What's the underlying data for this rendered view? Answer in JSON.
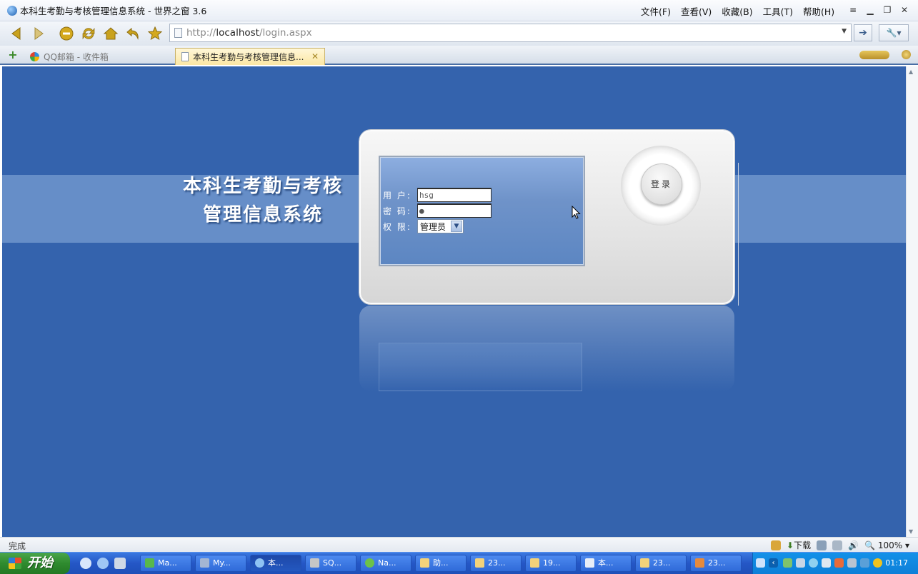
{
  "window": {
    "title": "本科生考勤与考核管理信息系统 - 世界之窗 3.6",
    "menus": [
      "文件(F)",
      "查看(V)",
      "收藏(B)",
      "工具(T)",
      "帮助(H)"
    ]
  },
  "address_bar": {
    "url_prefix": "http://",
    "url_host": "localhost",
    "url_path": "/login.aspx"
  },
  "tabs": [
    {
      "label": "QQ邮箱 - 收件箱",
      "active": false
    },
    {
      "label": "本科生考勤与考核管理信息...",
      "active": true
    }
  ],
  "page": {
    "system_title_line1": "本科生考勤与考核",
    "system_title_line2": "管理信息系统",
    "form": {
      "user_label": "用  户:",
      "user_value": "hsg",
      "password_label": "密  码:",
      "password_value": "●",
      "role_label": "权  限:",
      "role_value": "管理员"
    },
    "login_button": "登录"
  },
  "status": {
    "text": "完成",
    "download": "下载",
    "zoom": "100%"
  },
  "taskbar": {
    "start": "开始",
    "tasks": [
      "Ma...",
      "My...",
      "本...",
      "SQ...",
      "Na...",
      "助...",
      "23...",
      "19...",
      "本...",
      "23...",
      "23..."
    ],
    "clock": "01:17"
  },
  "colors": {
    "page_background": "#3463ad",
    "band": "#6c92cb",
    "taskbar": "#2557c6",
    "start_button": "#2f8b2f"
  }
}
